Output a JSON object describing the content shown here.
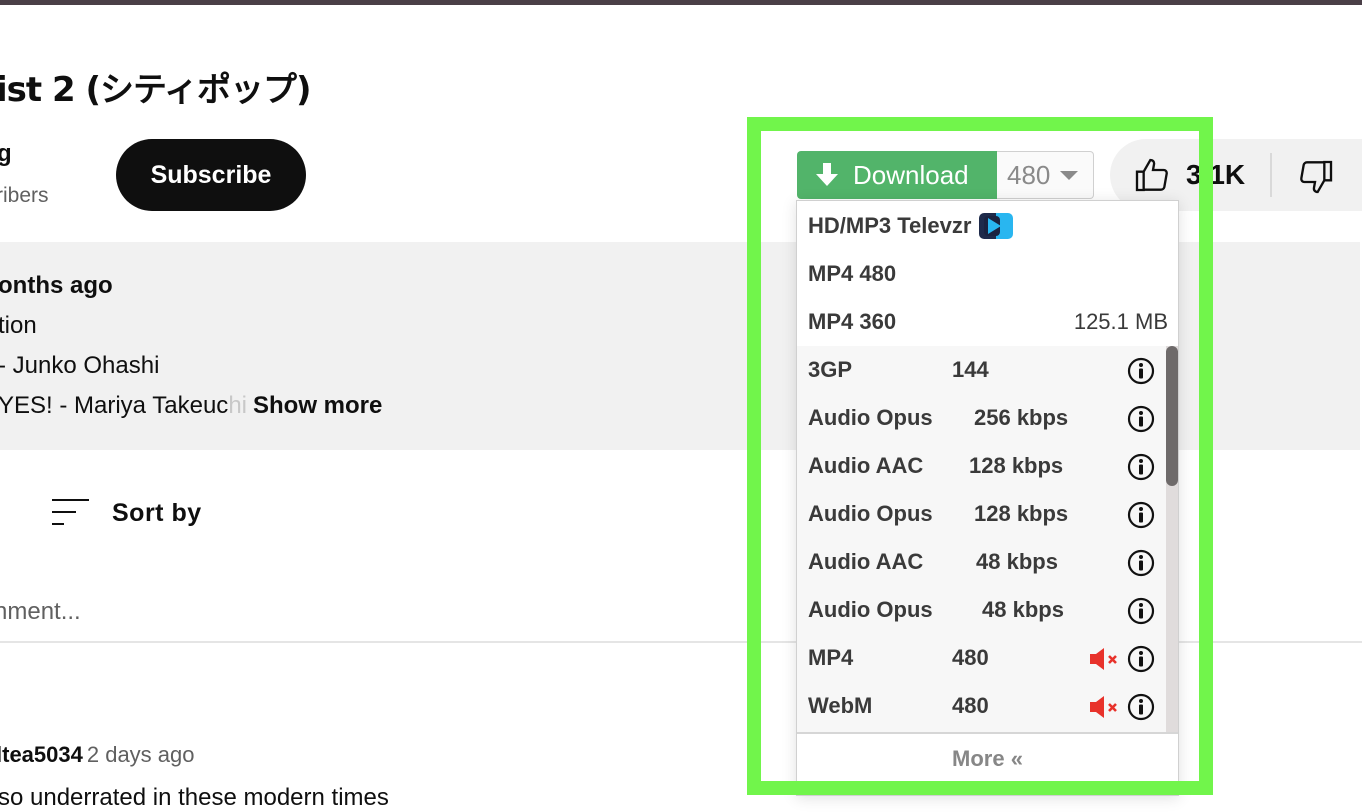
{
  "video": {
    "title": "ist 2 (シティポップ)",
    "channel_name": "g",
    "subscribers": "ribers",
    "subscribe_label": "Subscribe",
    "likes": "3.1K"
  },
  "description": {
    "line1": "onths ago",
    "line2": "tion",
    "line3": " - Junko Ohashi",
    "line4_main": "YES! - Mariya Takeuc",
    "line4_fade": "hi",
    "show_more": "Show more"
  },
  "comments": {
    "sort_label": "Sort by",
    "input_placeholder": "nment...",
    "first": {
      "author": "ltea5034",
      "ago": "2 days ago",
      "text": "so underrated in these modern times"
    }
  },
  "downloader": {
    "button_label": "Download",
    "selected_quality": "480",
    "accent_color": "#52b46a",
    "top_items": [
      {
        "label": "HD/MP3 Televzr",
        "icon": "televzr-logo-icon"
      },
      {
        "label": "MP4 480"
      },
      {
        "label": "MP4 360",
        "size": "125.1 MB"
      }
    ],
    "items": [
      {
        "format": "3GP",
        "quality": "144",
        "muted": false
      },
      {
        "format": "Audio Opus",
        "quality": "256 kbps",
        "muted": false
      },
      {
        "format": "Audio AAC",
        "quality": "128 kbps",
        "muted": false
      },
      {
        "format": "Audio Opus",
        "quality": "128 kbps",
        "muted": false
      },
      {
        "format": "Audio AAC",
        "quality": "48 kbps",
        "muted": false
      },
      {
        "format": "Audio Opus",
        "quality": "48 kbps",
        "muted": false
      },
      {
        "format": "MP4",
        "quality": "480",
        "muted": true
      },
      {
        "format": "WebM",
        "quality": "480",
        "muted": true
      }
    ],
    "more_label": "More «",
    "highlight_color": "#71f54b"
  }
}
